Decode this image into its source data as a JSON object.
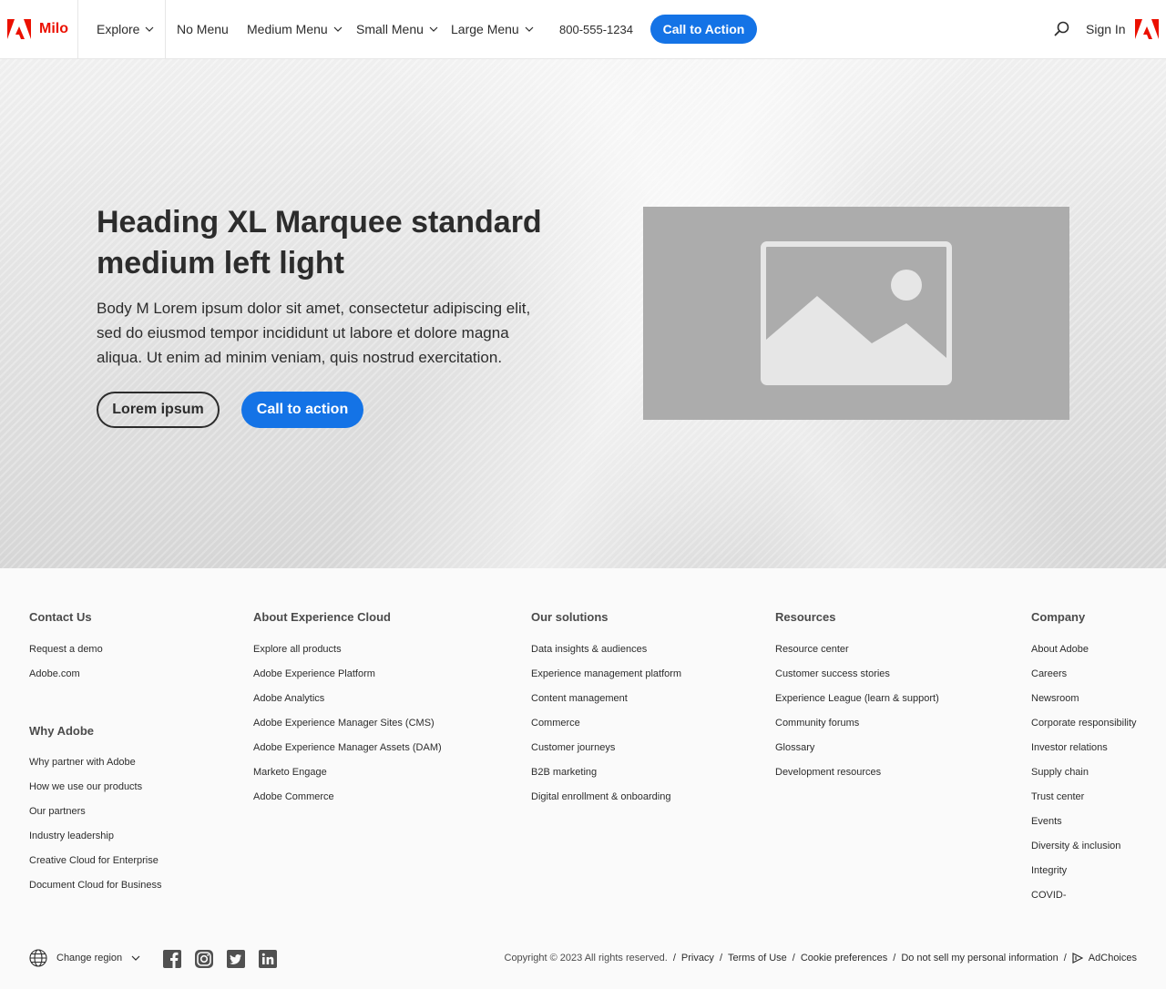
{
  "nav": {
    "brand": "Milo",
    "explore": "Explore",
    "items": [
      "No Menu",
      "Medium Menu",
      "Small Menu",
      "Large Menu"
    ],
    "phone": "800-555-1234",
    "cta": "Call to Action",
    "signin": "Sign In"
  },
  "hero": {
    "title": "Heading XL Marquee standard medium left light",
    "body": "Body M Lorem ipsum dolor sit amet, consectetur adipiscing elit, sed do eiusmod tempor incididunt ut labore et dolore magna aliqua. Ut enim ad minim veniam, quis nostrud exercitation.",
    "secondary_button": "Lorem ipsum",
    "primary_button": "Call to action"
  },
  "footer": {
    "contact": {
      "heading": "Contact Us",
      "links": [
        "Request a demo",
        "Adobe.com"
      ]
    },
    "why": {
      "heading": "Why Adobe",
      "links": [
        "Why partner with Adobe",
        "How we use our products",
        "Our partners",
        "Industry leadership",
        "Creative Cloud for Enterprise",
        "Document Cloud for Business"
      ]
    },
    "about": {
      "heading": "About Experience Cloud",
      "links": [
        "Explore all products",
        "Adobe Experience Platform",
        "Adobe Analytics",
        "Adobe Experience Manager Sites (CMS)",
        "Adobe Experience Manager Assets (DAM)",
        "Marketo Engage",
        "Adobe Commerce"
      ]
    },
    "solutions": {
      "heading": "Our solutions",
      "links": [
        "Data insights & audiences",
        "Experience management platform",
        "Content management",
        "Commerce",
        "Customer journeys",
        "B2B marketing",
        "Digital enrollment & onboarding"
      ]
    },
    "resources": {
      "heading": "Resources",
      "links": [
        "Resource center",
        "Customer success stories",
        "Experience League (learn & support)",
        "Community forums",
        "Glossary",
        "Development resources"
      ]
    },
    "company": {
      "heading": "Company",
      "links": [
        "About Adobe",
        "Careers",
        "Newsroom",
        "Corporate responsibility",
        "Investor relations",
        "Supply chain",
        "Trust center",
        "Events",
        "Diversity & inclusion",
        "Integrity",
        "COVID-"
      ]
    },
    "region": "Change region",
    "copyright": "Copyright © 2023 All rights reserved.",
    "legal": [
      "Privacy",
      "Terms of Use",
      "Cookie preferences",
      "Do not sell my personal information",
      "AdChoices"
    ],
    "social_icons": [
      "facebook-icon",
      "instagram-icon",
      "twitter-icon",
      "linkedin-icon"
    ]
  },
  "colors": {
    "accent": "#1473e6",
    "brand": "#eb1000",
    "footer_bg": "#fafafa",
    "image_placeholder": "#acacac"
  }
}
